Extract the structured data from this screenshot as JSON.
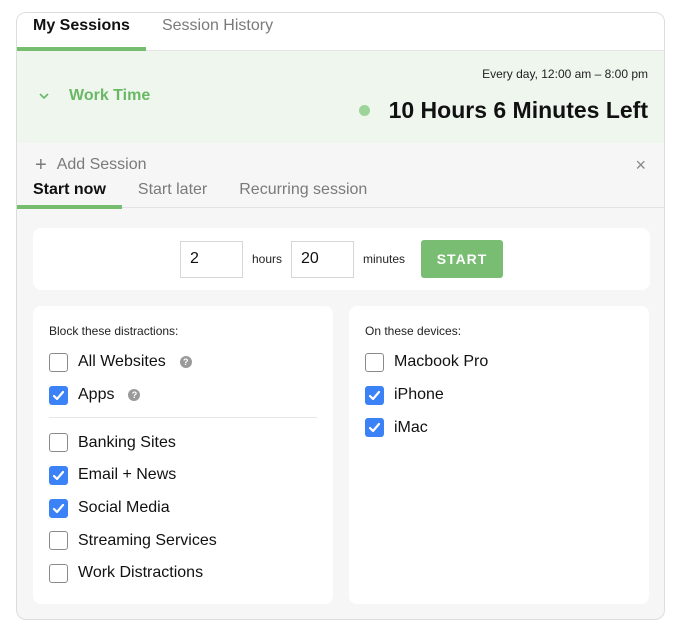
{
  "tabs": [
    {
      "label": "My Sessions",
      "active": true
    },
    {
      "label": "Session History",
      "active": false
    }
  ],
  "session": {
    "name": "Work Time",
    "schedule": "Every day, 12:00 am – 8:00 pm",
    "time_left": "10 Hours 6 Minutes Left",
    "status_color": "#9dd49a"
  },
  "add_session": {
    "label": "Add Session",
    "plus_icon": "+",
    "close_icon": "×",
    "tabs": [
      {
        "label": "Start now",
        "active": true
      },
      {
        "label": "Start later",
        "active": false
      },
      {
        "label": "Recurring session",
        "active": false
      }
    ],
    "hours_value": "2",
    "hours_label": "hours",
    "minutes_value": "20",
    "minutes_label": "minutes",
    "start_label": "START"
  },
  "distractions": {
    "title": "Block these distractions:",
    "primary": [
      {
        "label": "All Websites",
        "checked": false,
        "help": true
      },
      {
        "label": "Apps",
        "checked": true,
        "help": true
      }
    ],
    "categories": [
      {
        "label": "Banking Sites",
        "checked": false
      },
      {
        "label": "Email + News",
        "checked": true
      },
      {
        "label": "Social Media",
        "checked": true
      },
      {
        "label": "Streaming Services",
        "checked": false
      },
      {
        "label": "Work Distractions",
        "checked": false
      }
    ]
  },
  "devices": {
    "title": "On these devices:",
    "items": [
      {
        "label": "Macbook Pro",
        "checked": false
      },
      {
        "label": "iPhone",
        "checked": true
      },
      {
        "label": "iMac",
        "checked": true
      }
    ]
  },
  "colors": {
    "accent_green": "#76bd70",
    "checkbox_blue": "#3b82f6",
    "session_bg": "#eef6ee"
  }
}
